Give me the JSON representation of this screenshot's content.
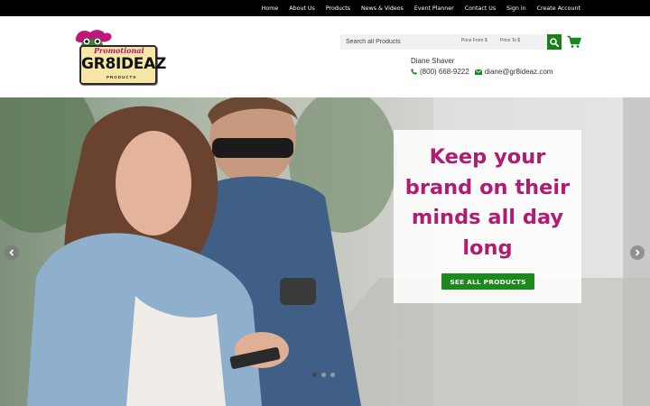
{
  "topnav": {
    "items": [
      {
        "label": "Home"
      },
      {
        "label": "About Us"
      },
      {
        "label": "Products"
      },
      {
        "label": "News & Videos"
      },
      {
        "label": "Event Planner"
      },
      {
        "label": "Contact Us"
      },
      {
        "label": "Sign in"
      },
      {
        "label": "Create Account"
      }
    ]
  },
  "logo": {
    "script_text": "Promotional",
    "main_text": "GR8IDEAZ",
    "sub_text": "PRODUCTS",
    "icon": "frog-mascot-icon"
  },
  "search": {
    "placeholder": "Search all Products",
    "price_from_placeholder": "Price From $",
    "price_to_placeholder": "Price To $",
    "button_icon": "search-icon",
    "cart_icon": "cart-icon"
  },
  "contact": {
    "name": "Diane Shaver",
    "phone": "(800) 668-9222",
    "email": "diane@gr8ideaz.com",
    "phone_icon": "phone-icon",
    "email_icon": "envelope-icon"
  },
  "hero": {
    "heading": "Keep your brand on their minds all day long",
    "button_label": "SEE ALL PRODUCTS",
    "prev_icon": "chevron-left-icon",
    "next_icon": "chevron-right-icon",
    "slides_total": 3,
    "active_slide": 1
  },
  "colors": {
    "accent_magenta": "#b01c73",
    "accent_green": "#1a8a1a",
    "topbar": "#000000"
  }
}
